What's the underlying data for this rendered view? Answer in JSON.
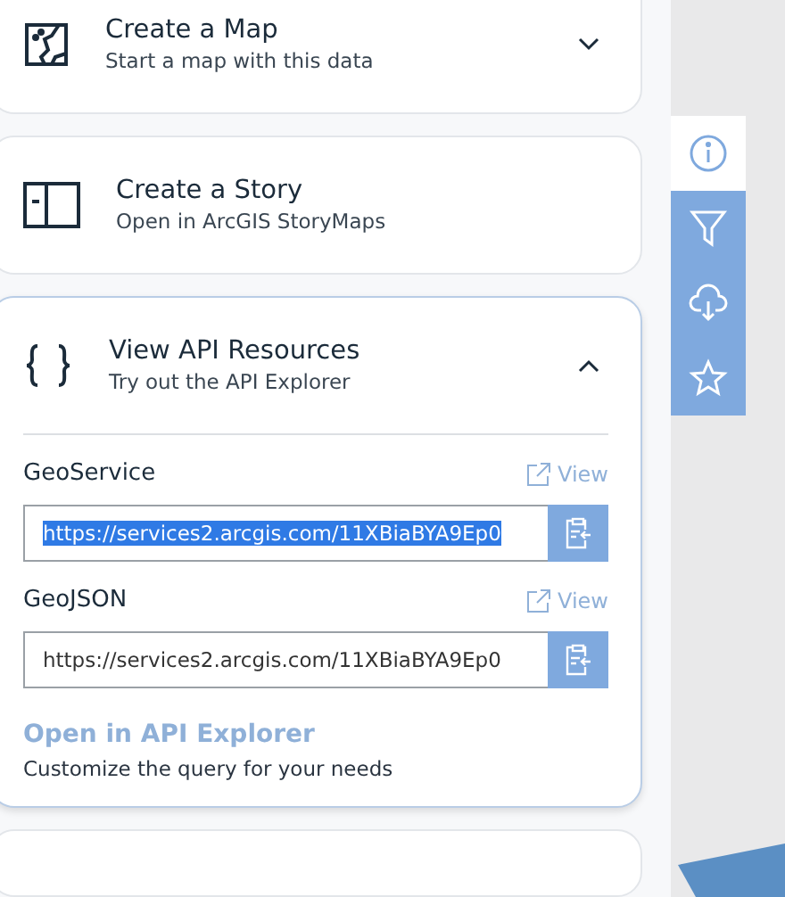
{
  "actions": [
    {
      "kind": "map",
      "title": "Create a Map",
      "subtitle": "Start a map with this data",
      "expanded": false
    },
    {
      "kind": "story",
      "title": "Create a Story",
      "subtitle": "Open in ArcGIS StoryMaps"
    },
    {
      "kind": "api",
      "title": "View API Resources",
      "subtitle": "Try out the API Explorer",
      "expanded": true
    }
  ],
  "api_resources": [
    {
      "label": "GeoService",
      "view": "View",
      "url": "https://services2.arcgis.com/11XBiaBYA9Ep0",
      "selected": true
    },
    {
      "label": "GeoJSON",
      "view": "View",
      "url": "https://services2.arcgis.com/11XBiaBYA9Ep0",
      "selected": false
    }
  ],
  "explorer_link": {
    "title": "Open in API Explorer",
    "description": "Customize the query for your needs"
  },
  "side_toolbar": [
    {
      "kind": "info",
      "selected": true
    },
    {
      "kind": "filter",
      "selected": false
    },
    {
      "kind": "download",
      "selected": false
    },
    {
      "kind": "favorite",
      "selected": false
    }
  ]
}
